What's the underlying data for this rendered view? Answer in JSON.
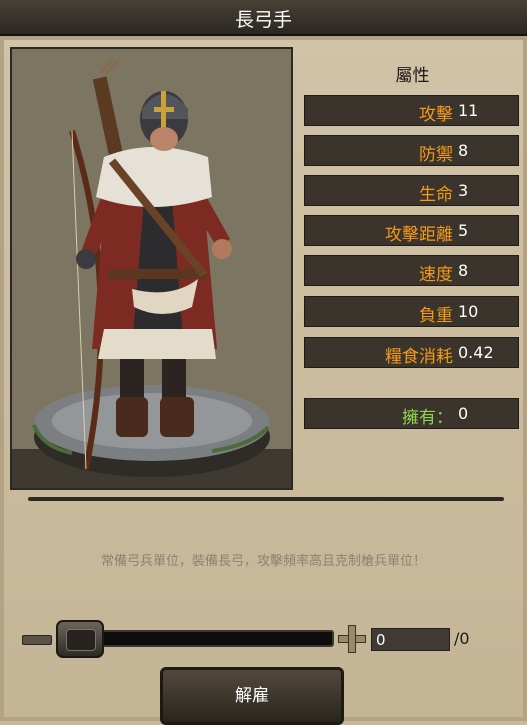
{
  "window": {
    "title": "長弓手"
  },
  "unit": {
    "portrait_icon": "longbowman-portrait",
    "attributes_heading": "屬性",
    "stats": [
      {
        "label": "攻擊",
        "value": "11"
      },
      {
        "label": "防禦",
        "value": "8"
      },
      {
        "label": "生命",
        "value": "3"
      },
      {
        "label": "攻擊距離",
        "value": "5"
      },
      {
        "label": "速度",
        "value": "8"
      },
      {
        "label": "負重",
        "value": "10"
      },
      {
        "label": "糧食消耗",
        "value": "0.42"
      }
    ],
    "owned": {
      "label": "擁有：",
      "value": "0"
    },
    "description": "常備弓兵單位，裝備長弓，攻擊頻率高且克制槍兵單位！"
  },
  "quantity": {
    "value": "0",
    "max_label": "/0",
    "slider_fraction": 0
  },
  "actions": {
    "dismiss_label": "解雇"
  },
  "colors": {
    "stat_label": "#f49a16",
    "owned_label": "#8fd64f",
    "panel_bg": "#c9b99c",
    "row_bg": "#3b342c"
  }
}
